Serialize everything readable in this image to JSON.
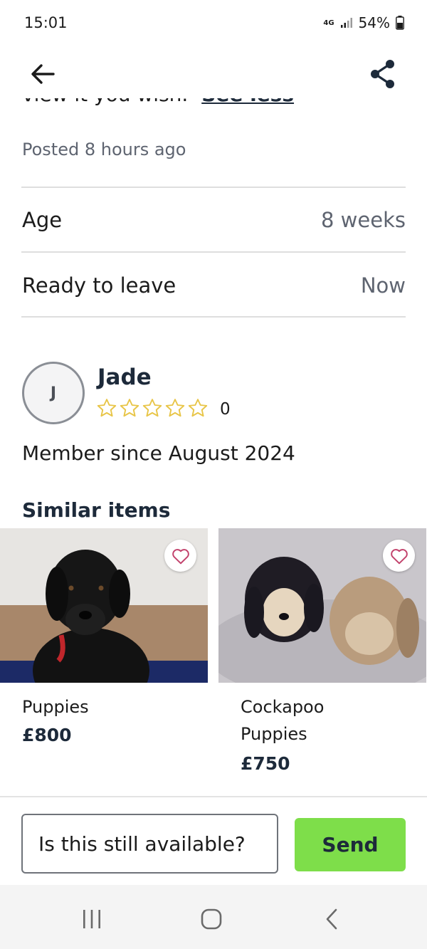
{
  "status_bar": {
    "time": "15:01",
    "network": "4G",
    "battery": "54%"
  },
  "app_bar": {
    "back_icon": "arrow-left-icon",
    "share_icon": "share-icon"
  },
  "description": {
    "cut_text": "view it you wish.",
    "see_less": "See less"
  },
  "posted": "Posted 8 hours ago",
  "details": [
    {
      "label": "Age",
      "value": "8 weeks"
    },
    {
      "label": "Ready to leave",
      "value": "Now"
    }
  ],
  "seller": {
    "initial": "J",
    "name": "Jade",
    "rating_count": "0",
    "member_since": "Member since August 2024"
  },
  "similar": {
    "title": "Similar items",
    "items": [
      {
        "title": "Puppies",
        "price": "£800"
      },
      {
        "title": "Cockapoo Puppies",
        "price": "£750"
      }
    ]
  },
  "composer": {
    "message": "Is this still available?",
    "send_label": "Send"
  },
  "colors": {
    "accent_green": "#7ede4a",
    "heading_navy": "#1d2a3a",
    "star_yellow": "#e8c547",
    "heart_pink": "#c2416b"
  }
}
